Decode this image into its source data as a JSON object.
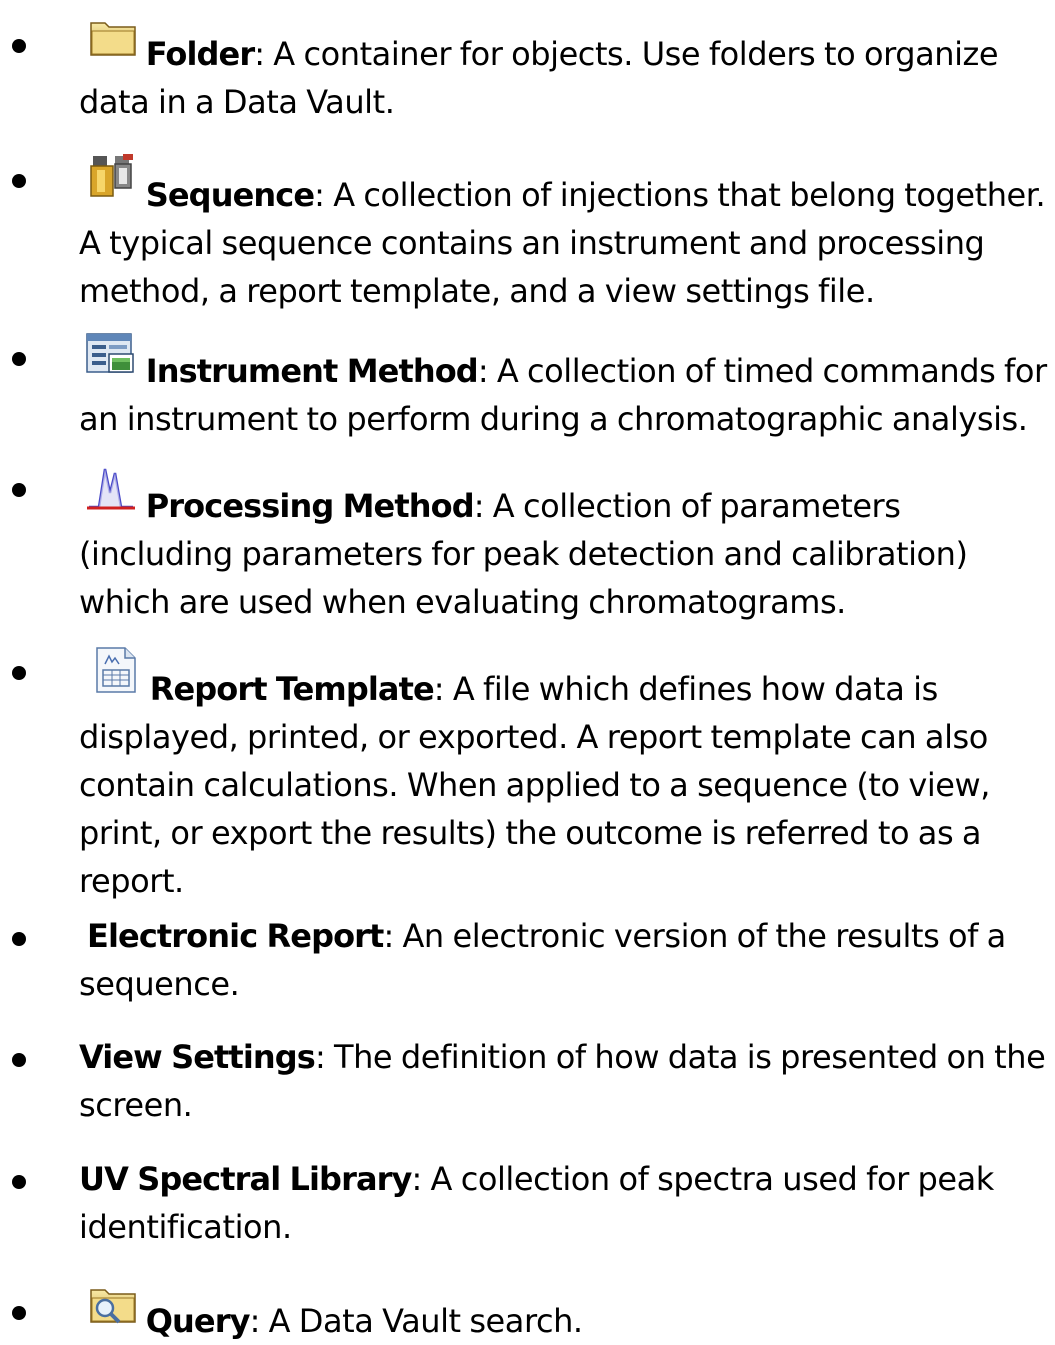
{
  "items": [
    {
      "term": "Folder",
      "desc": ": A container for objects. Use folders to organize data in a Data Vault.",
      "icon": "folder-icon"
    },
    {
      "term": "Sequence",
      "desc": ": A collection of injections that belong together. A typical sequence contains an instrument and processing method, a report template, and a view settings file.",
      "icon": "sequence-icon"
    },
    {
      "term": "Instrument Method",
      "desc": ": A collection of timed commands for an instrument to perform during a chromatographic analysis.",
      "icon": "instrument-method-icon"
    },
    {
      "term": "Processing Method",
      "desc": ": A collection of parameters (including parameters for peak detection and calibration) which are used when evaluating chromatograms.",
      "icon": "processing-method-icon"
    },
    {
      "term": "Report Template",
      "desc": ": A file which defines how data is displayed, printed, or exported. A report template can also contain calculations. When applied to a sequence (to view, print, or export the results) the outcome is referred to as a report.",
      "icon": "report-template-icon"
    },
    {
      "term": "Electronic Report",
      "desc": ": An electronic version of the results of a sequence.",
      "icon": ""
    },
    {
      "term": "View Settings",
      "desc": ": The definition of how data is presented on the screen.",
      "icon": ""
    },
    {
      "term": "UV Spectral Library",
      "desc": ": A collection of spectra used for peak identification.",
      "icon": ""
    },
    {
      "term": "Query",
      "desc": ": A Data Vault search.",
      "icon": "query-icon"
    }
  ]
}
